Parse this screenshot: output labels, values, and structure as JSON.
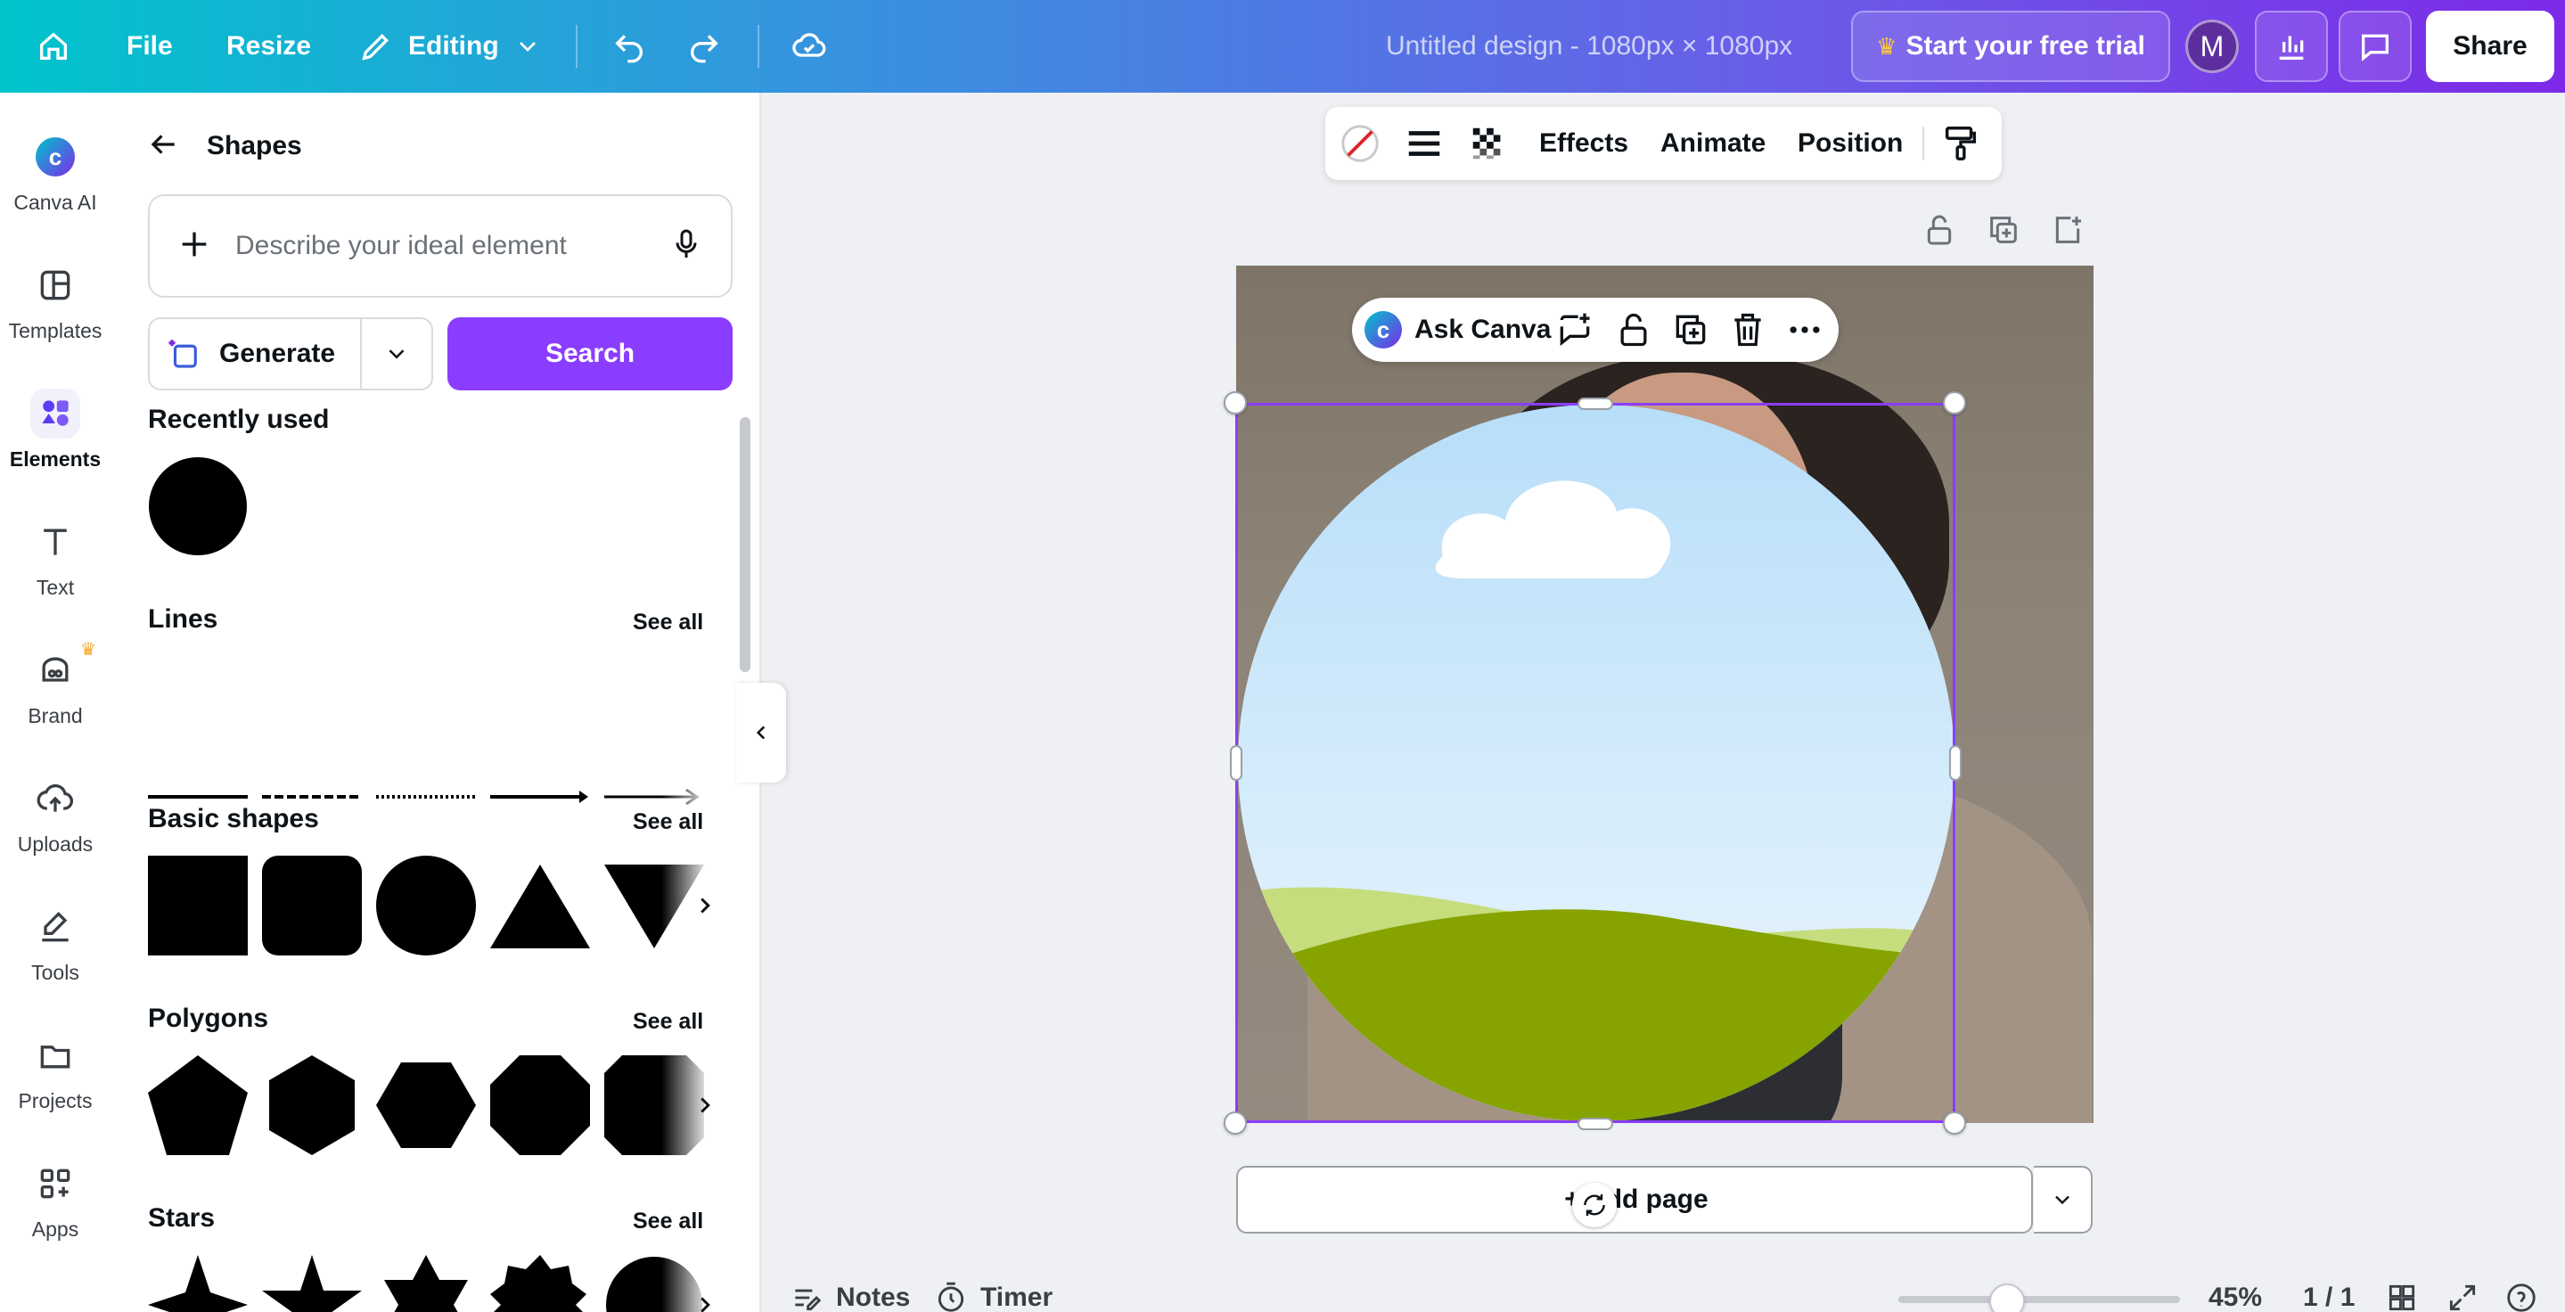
{
  "topbar": {
    "file_label": "File",
    "resize_label": "Resize",
    "editing_label": "Editing",
    "doc_title": "Untitled design - 1080px × 1080px",
    "trial_label": "Start your free trial",
    "avatar_initial": "M",
    "share_label": "Share"
  },
  "rail": {
    "items": [
      {
        "label": "Canva AI"
      },
      {
        "label": "Templates"
      },
      {
        "label": "Elements"
      },
      {
        "label": "Text"
      },
      {
        "label": "Brand"
      },
      {
        "label": "Uploads"
      },
      {
        "label": "Tools"
      },
      {
        "label": "Projects"
      },
      {
        "label": "Apps"
      }
    ]
  },
  "panel": {
    "title": "Shapes",
    "search_placeholder": "Describe your ideal element",
    "generate_label": "Generate",
    "search_label": "Search",
    "recently_used": "Recently used",
    "lines": "Lines",
    "basic_shapes": "Basic shapes",
    "polygons": "Polygons",
    "stars": "Stars",
    "see_all": "See all"
  },
  "context_toolbar": {
    "effects": "Effects",
    "animate": "Animate",
    "position": "Position"
  },
  "element_toolbar": {
    "ask_canva": "Ask Canva"
  },
  "canvas": {
    "add_page_label": "+ Add page"
  },
  "footer": {
    "notes": "Notes",
    "timer": "Timer",
    "zoom": "45%",
    "pages": "1 / 1"
  },
  "colors": {
    "accent": "#8b3dff",
    "sky": "#c9e8fb",
    "grass_light": "#c5dd7d",
    "grass_dark": "#86a300"
  }
}
